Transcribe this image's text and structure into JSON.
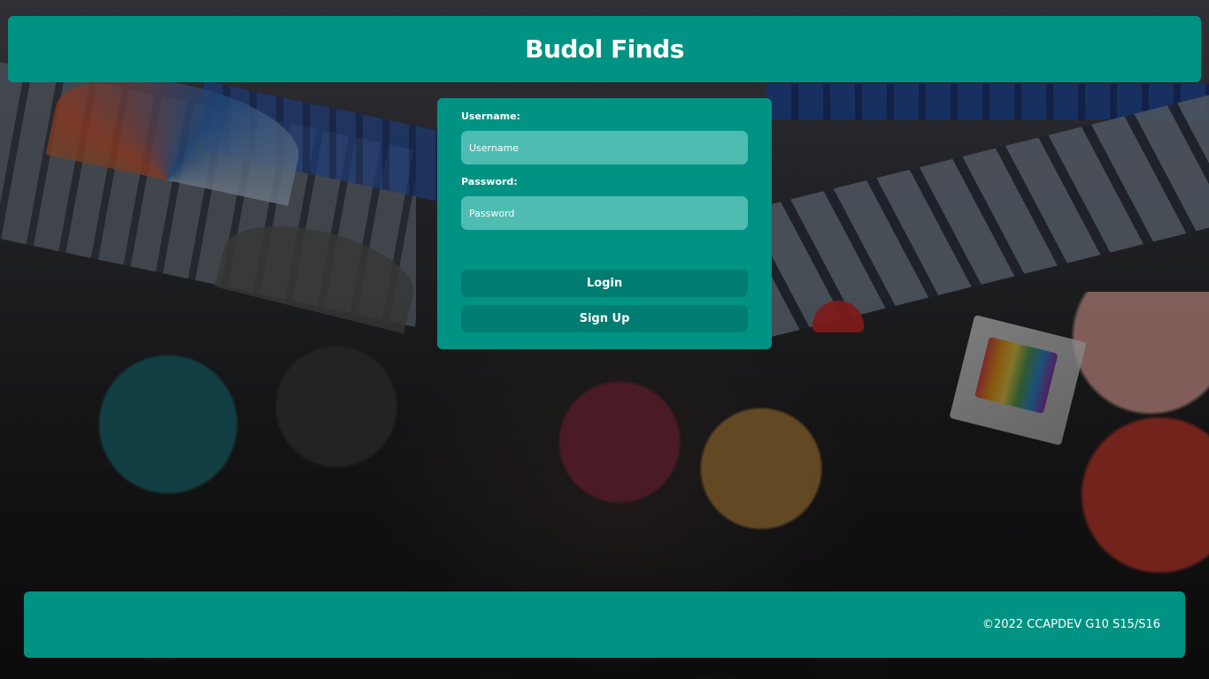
{
  "header": {
    "title": "Budol Finds"
  },
  "login_form": {
    "username_label": "Username:",
    "username_placeholder": "Username",
    "username_value": "",
    "password_label": "Password:",
    "password_placeholder": "Password",
    "password_value": "",
    "login_button": "Login",
    "signup_button": "Sign Up"
  },
  "footer": {
    "copyright": "©2022 CCAPDEV G10 S15/S16"
  },
  "colors": {
    "primary": "#009384",
    "input_bg": "#4fbcb1",
    "button_bg": "#007c70",
    "text": "#ffffff"
  },
  "background": {
    "description_icon": "market-crowd-photo"
  }
}
